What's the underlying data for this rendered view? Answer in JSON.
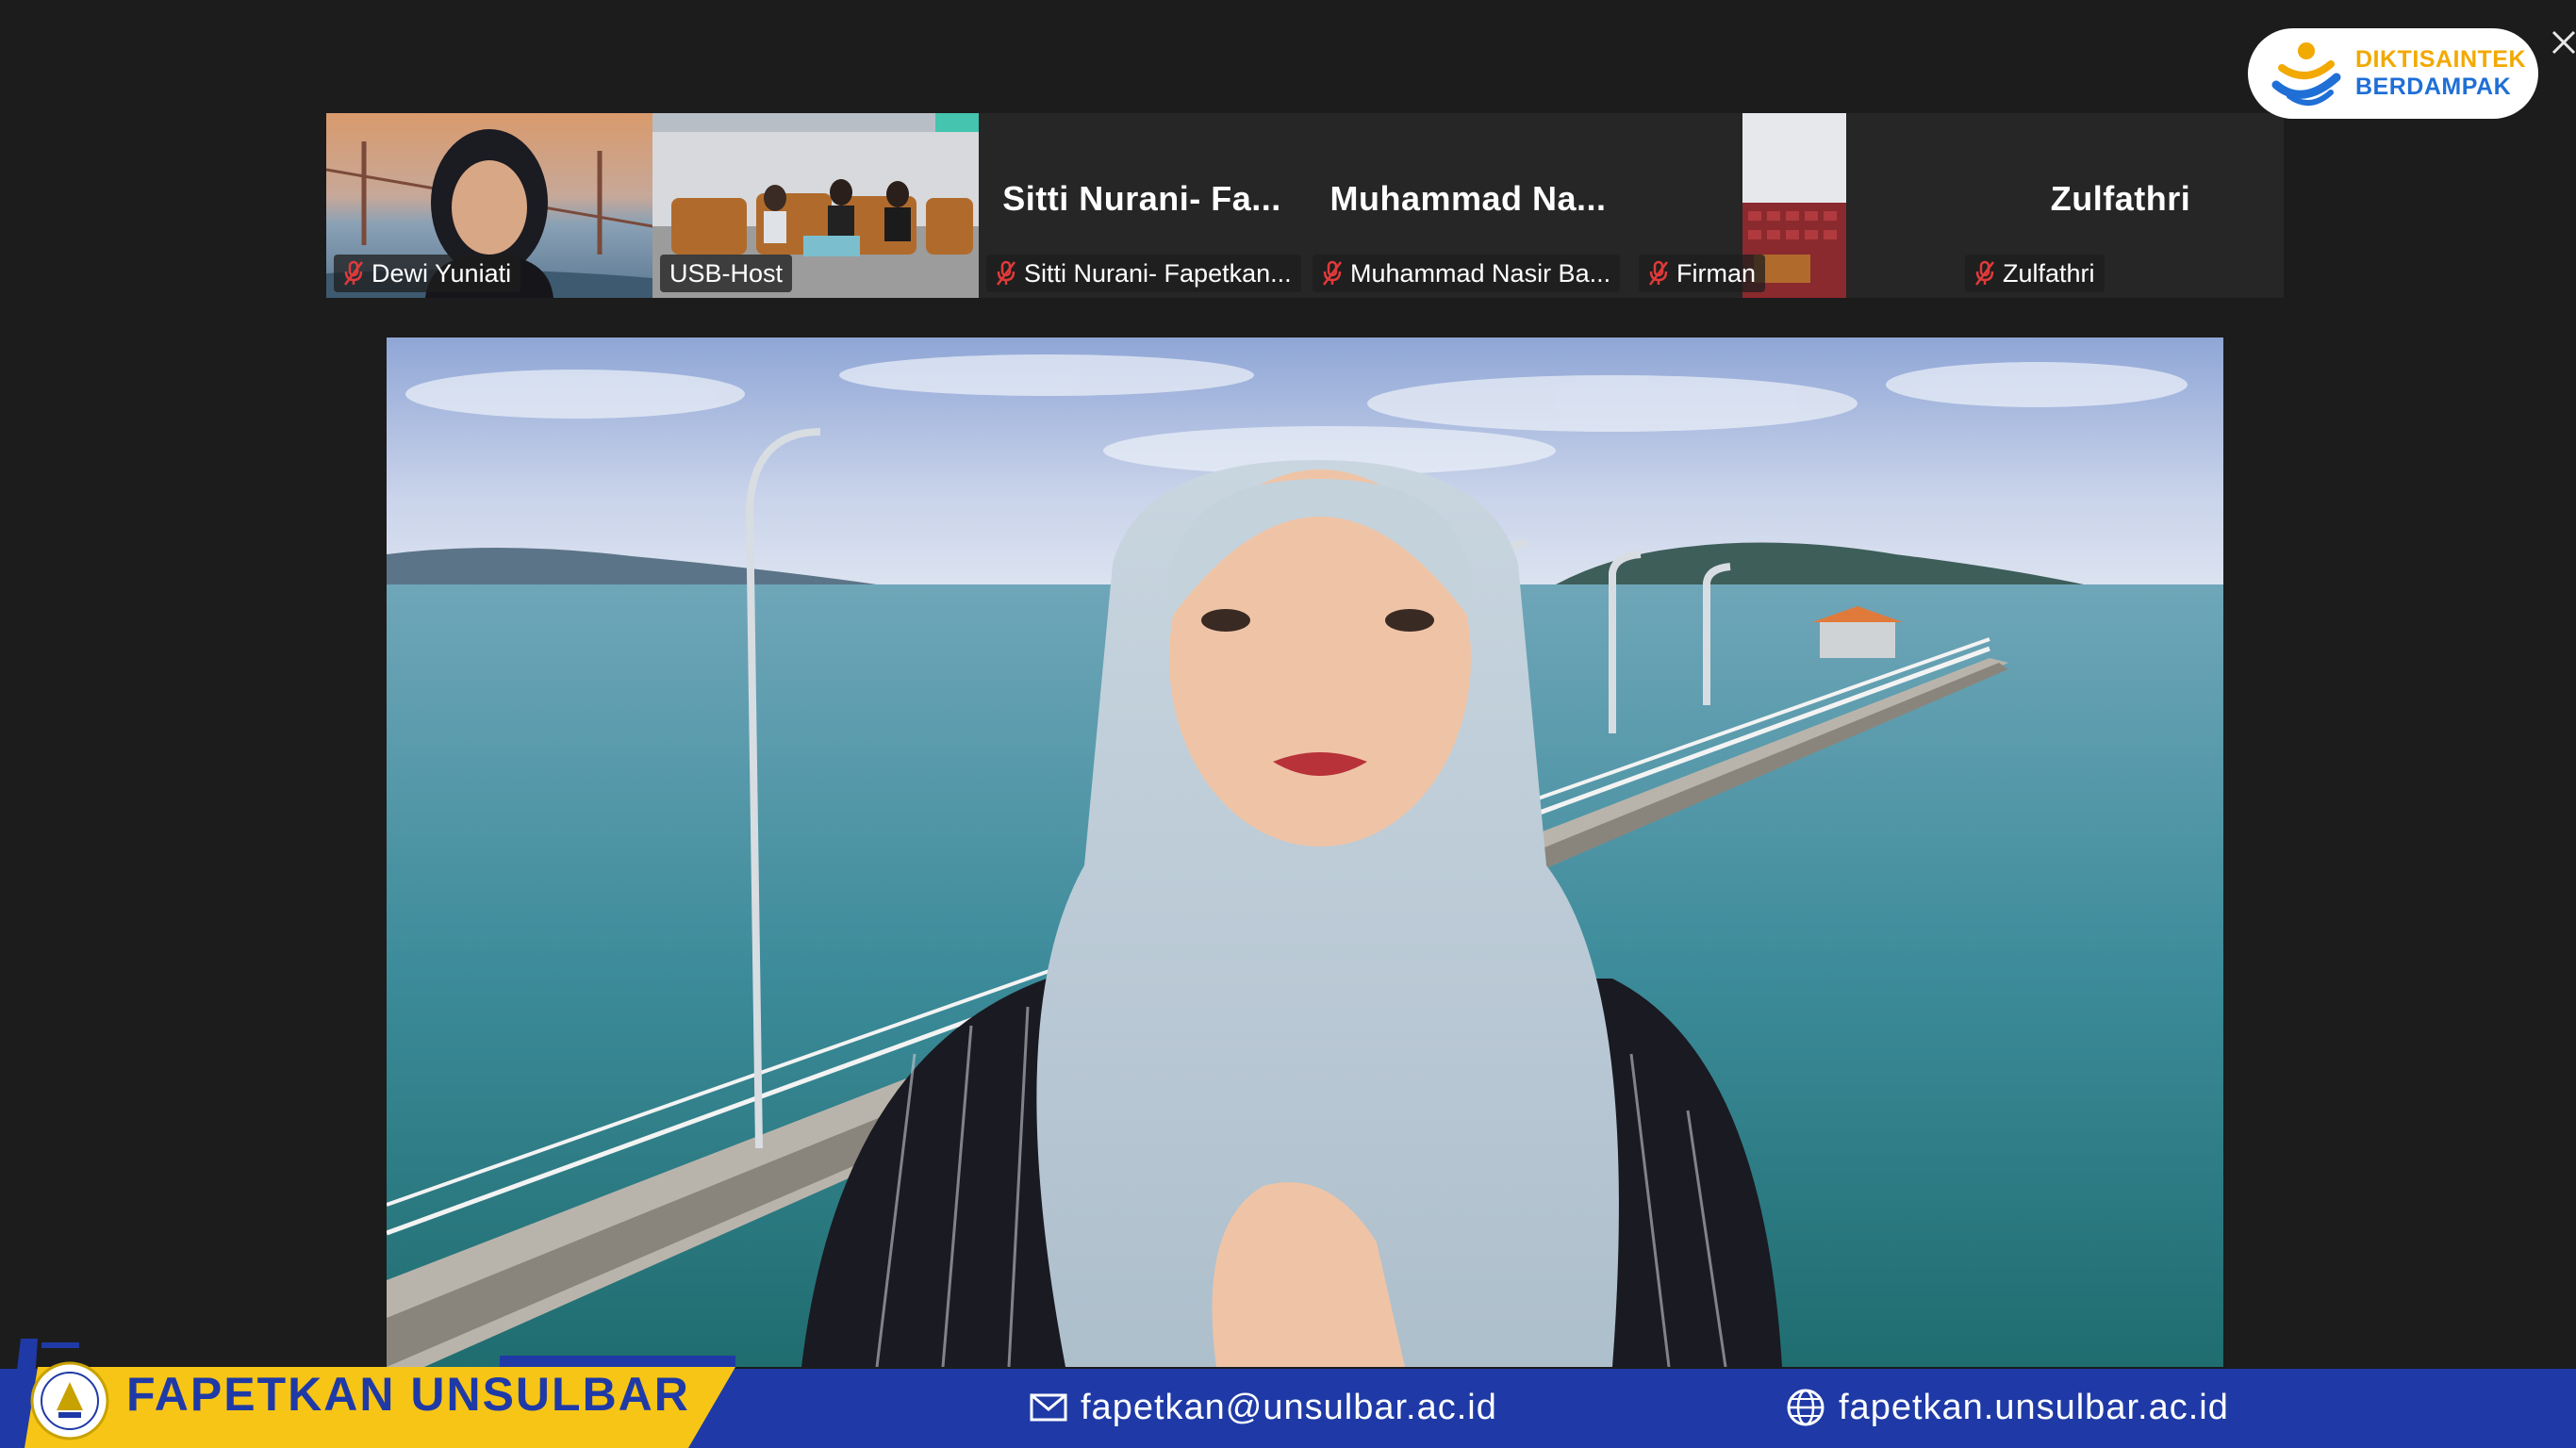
{
  "meeting": {
    "participants": [
      {
        "label": "Dewi Yuniati",
        "display_name": "",
        "muted": true,
        "has_video": true
      },
      {
        "label": "USB-Host",
        "display_name": "",
        "muted": false,
        "has_video": true
      },
      {
        "label": "Sitti Nurani- Fapetkan...",
        "display_name": "Sitti  Nurani-  Fa...",
        "muted": true,
        "has_video": false
      },
      {
        "label": "Muhammad Nasir Ba...",
        "display_name": "Muhammad  Na...",
        "muted": true,
        "has_video": false
      },
      {
        "label": "Firman",
        "display_name": "",
        "muted": true,
        "has_video": true
      },
      {
        "label": "Zulfathri",
        "display_name": "Zulfathri",
        "muted": true,
        "has_video": false
      }
    ],
    "close_icon": "close-icon",
    "mute_icon": "microphone-muted-icon"
  },
  "brand": {
    "logo_line1": "DIKTISAINTEK",
    "logo_line2": "BERDAMPAK",
    "line1_color": "#f2a900",
    "line2_color": "#1f6fd6"
  },
  "footer": {
    "title": "FAPETKAN UNSULBAR",
    "email": "fapetkan@unsulbar.ac.id",
    "website": "fapetkan.unsulbar.ac.id",
    "email_icon": "mail-icon",
    "website_icon": "globe-icon",
    "bar_color": "#1f3aa6",
    "accent_color": "#f7c516"
  }
}
